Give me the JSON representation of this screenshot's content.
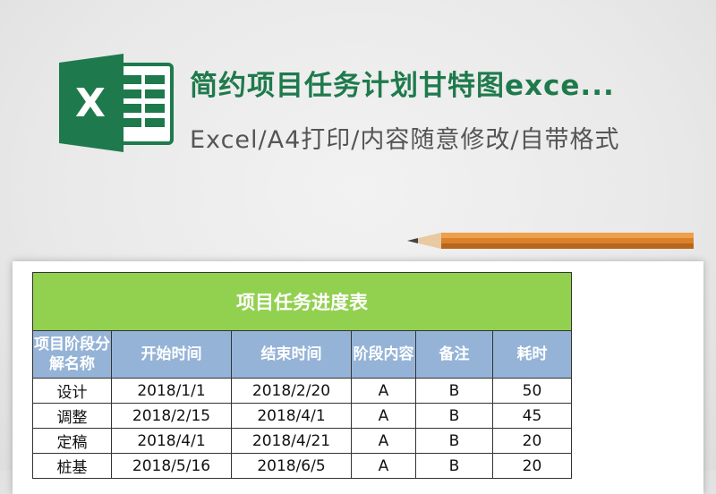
{
  "header": {
    "title": "简约项目任务计划甘特图exce...",
    "subtitle": "Excel/A4打印/内容随意修改/自带格式",
    "logo_letter": "X"
  },
  "sheet": {
    "title": "项目任务进度表",
    "columns": [
      "项目阶段分解名称",
      "开始时间",
      "结束时间",
      "阶段内容",
      "备注",
      "耗时"
    ],
    "rows": [
      [
        "设计",
        "2018/1/1",
        "2018/2/20",
        "A",
        "B",
        "50"
      ],
      [
        "调整",
        "2018/2/15",
        "2018/4/1",
        "A",
        "B",
        "45"
      ],
      [
        "定稿",
        "2018/4/1",
        "2018/4/21",
        "A",
        "B",
        "20"
      ],
      [
        "桩基",
        "2018/5/16",
        "2018/6/5",
        "A",
        "B",
        "20"
      ]
    ]
  },
  "colors": {
    "brand_green": "#1e7a4c",
    "title_bar": "#92d050",
    "header_bar": "#95b3d7"
  }
}
